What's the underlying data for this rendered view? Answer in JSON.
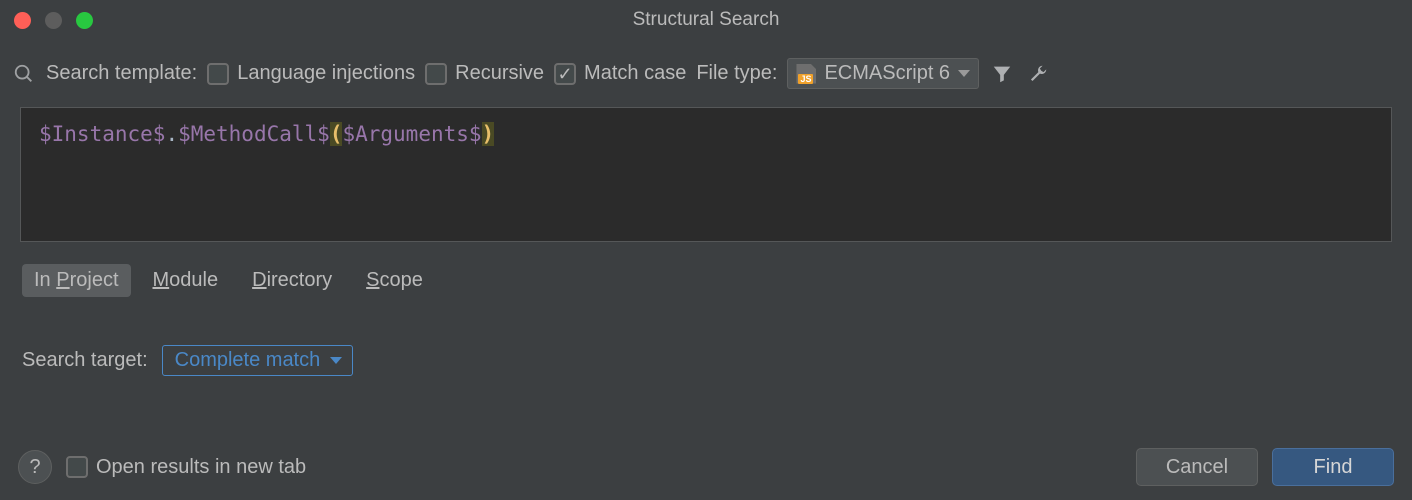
{
  "title": "Structural Search",
  "toolbar": {
    "search_template_label": "Search template:",
    "language_injections_label": "Language injections",
    "recursive_label": "Recursive",
    "match_case_label": "Match case",
    "file_type_label": "File type:",
    "file_type_value": "ECMAScript 6"
  },
  "editor": {
    "tokens": {
      "instance": "$Instance$",
      "dot": ".",
      "method": "$MethodCall$",
      "lparen": "(",
      "arguments": "$Arguments$",
      "rparen": ")"
    }
  },
  "scope_tabs": {
    "in_project": "In Project",
    "module": "Module",
    "directory": "Directory",
    "scope": "Scope"
  },
  "search_target": {
    "label": "Search target:",
    "value": "Complete match"
  },
  "footer": {
    "help": "?",
    "open_new_tab_label": "Open results in new tab",
    "cancel": "Cancel",
    "find": "Find"
  }
}
